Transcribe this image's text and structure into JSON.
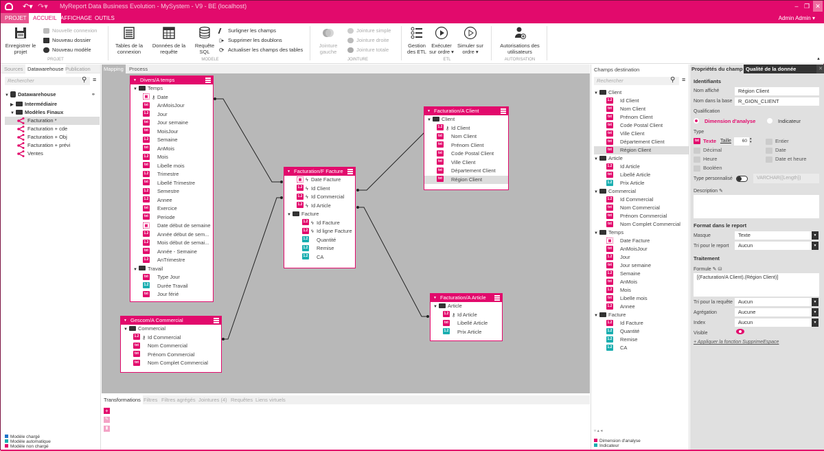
{
  "app": {
    "title": "MyReport Data Business Evolution - MySystem - V9 - BE (localhost)",
    "user": "Admin Admin",
    "accent": "#e20a6c",
    "measure_color": "#1aaeb0"
  },
  "ribbon_tabs": [
    "PROJET",
    "ACCUEIL",
    "AFFICHAGE",
    "OUTILS"
  ],
  "active_ribbon_tab": "ACCUEIL",
  "ribbon": {
    "projet": {
      "save": "Enregistrer le projet",
      "new_connection": "Nouvelle connexion",
      "new_folder": "Nouveau dossier",
      "new_model": "Nouveau modèle",
      "group": "PROJET"
    },
    "modele": {
      "tables": "Tables de la connexion",
      "data": "Données de la requête",
      "sql": "Requête SQL",
      "highlight": "Surligner les champs",
      "dedupe": "Supprimer les doublons",
      "refresh": "Actualiser les champs des tables",
      "group": "MODELE"
    },
    "jointure": {
      "left": "Jointure gauche",
      "simple": "Jointure simple",
      "right": "Jointure droite",
      "full": "Jointure totale",
      "group": "JOINTURE"
    },
    "etl": {
      "manage": "Gestion des ETL",
      "run": "Exécuter sur ordre ▾",
      "simulate": "Simuler sur ordre ▾",
      "group": "ETL"
    },
    "autorisation": {
      "users": "Autorisations des utilisateurs",
      "group": "AUTORISATION"
    }
  },
  "left_panel": {
    "tabs": [
      "Sources",
      "Datawarehouse",
      "Publication"
    ],
    "active_tab": "Datawarehouse",
    "search_placeholder": "Rechercher",
    "root": "Datawarehouse",
    "folders": [
      "Intermédiaire",
      "Modèles Finaux"
    ],
    "models": [
      "Facturation *",
      "Facturation + cde",
      "Facturation + Obj",
      "Facturation + prévi",
      "Ventes"
    ],
    "selected_model": "Facturation *",
    "legend": [
      {
        "label": "Modèle chargé",
        "color": "#1e73c8"
      },
      {
        "label": "Modèle automatique",
        "color": "#1aaeb0"
      },
      {
        "label": "Modèle non chargé",
        "color": "#e20a6c"
      }
    ]
  },
  "canvas": {
    "tabs": [
      "Mapping",
      "Process"
    ],
    "active_tab": "Mapping",
    "tables": {
      "temps": {
        "title": "Divers/A temps",
        "folders": [
          {
            "name": "Temps",
            "fields": [
              {
                "name": "Date",
                "type": "date",
                "key": true
              },
              {
                "name": "AnMoisJour",
                "type": "txt"
              },
              {
                "name": "Jour",
                "type": "num"
              },
              {
                "name": "Jour semaine",
                "type": "txt"
              },
              {
                "name": "MoisJour",
                "type": "txt"
              },
              {
                "name": "Semaine",
                "type": "num"
              },
              {
                "name": "AnMois",
                "type": "txt"
              },
              {
                "name": "Mois",
                "type": "num"
              },
              {
                "name": "Libelle mois",
                "type": "txt"
              },
              {
                "name": "Trimestre",
                "type": "num"
              },
              {
                "name": "Libellé Trimestre",
                "type": "txt"
              },
              {
                "name": "Semestre",
                "type": "num"
              },
              {
                "name": "Annee",
                "type": "num"
              },
              {
                "name": "Exercice",
                "type": "txt"
              },
              {
                "name": "Periode",
                "type": "txt"
              },
              {
                "name": "Date début de semaine",
                "type": "date"
              },
              {
                "name": "Année début de sem...",
                "type": "num"
              },
              {
                "name": "Mois début de semai...",
                "type": "num"
              },
              {
                "name": "Année - Semaine",
                "type": "txt"
              },
              {
                "name": "AnTrimestre",
                "type": "num"
              }
            ]
          },
          {
            "name": "Travail",
            "fields": [
              {
                "name": "Type Jour",
                "type": "txt"
              },
              {
                "name": "Durée Travail",
                "type": "numc"
              },
              {
                "name": "Jour férié",
                "type": "txt"
              }
            ]
          }
        ]
      },
      "facture": {
        "title": "Facturation/F Facture",
        "root_fields": [
          {
            "name": "Date Facture",
            "type": "date",
            "fk": true
          },
          {
            "name": "Id Client",
            "type": "num",
            "fk": true
          },
          {
            "name": "Id Commercial",
            "type": "num",
            "fk": true
          },
          {
            "name": "Id Article",
            "type": "num",
            "fk": true
          }
        ],
        "folders": [
          {
            "name": "Facture",
            "fields": [
              {
                "name": "Id Facture",
                "type": "num",
                "fk": true
              },
              {
                "name": "Id ligne Facture",
                "type": "num",
                "fk": true
              },
              {
                "name": "Quantité",
                "type": "numc"
              },
              {
                "name": "Remise",
                "type": "numc"
              },
              {
                "name": "CA",
                "type": "numc"
              }
            ]
          }
        ]
      },
      "client": {
        "title": "Facturation/A Client",
        "folders": [
          {
            "name": "Client",
            "fields": [
              {
                "name": "Id Client",
                "type": "num",
                "key": true
              },
              {
                "name": "Nom Client",
                "type": "txt"
              },
              {
                "name": "Prénom Client",
                "type": "txt"
              },
              {
                "name": "Code Postal Client",
                "type": "txt"
              },
              {
                "name": "Ville Client",
                "type": "txt"
              },
              {
                "name": "Département Client",
                "type": "txt"
              },
              {
                "name": "Région Client",
                "type": "txt",
                "selected": true
              }
            ]
          }
        ]
      },
      "commercial": {
        "title": "Gescom/A Commercial",
        "folders": [
          {
            "name": "Commercial",
            "fields": [
              {
                "name": "Id Commercial",
                "type": "num",
                "key": true
              },
              {
                "name": "Nom Commercial",
                "type": "txt"
              },
              {
                "name": "Prénom Commercial",
                "type": "txt"
              },
              {
                "name": "Nom Complet Commercial",
                "type": "txt"
              }
            ]
          }
        ]
      },
      "article": {
        "title": "Facturation/A Article",
        "folders": [
          {
            "name": "Article",
            "fields": [
              {
                "name": "Id Article",
                "type": "num",
                "key": true
              },
              {
                "name": "Libellé Article",
                "type": "txt"
              },
              {
                "name": "Prix Article",
                "type": "numc"
              }
            ]
          }
        ]
      }
    }
  },
  "bottom_panel": {
    "tabs": [
      "Transformations",
      "Filtres",
      "Filtres agrégés",
      "Jointures (4)",
      "Requêtes",
      "Liens virtuels"
    ],
    "active_tab": "Transformations"
  },
  "dest_panel": {
    "title": "Champs destination",
    "search_placeholder": "Rechercher",
    "folders": [
      {
        "name": "Client",
        "fields": [
          {
            "name": "Id Client",
            "type": "num"
          },
          {
            "name": "Nom Client",
            "type": "txt"
          },
          {
            "name": "Prénom Client",
            "type": "txt"
          },
          {
            "name": "Code Postal Client",
            "type": "txt"
          },
          {
            "name": "Ville Client",
            "type": "txt"
          },
          {
            "name": "Département Client",
            "type": "txt"
          },
          {
            "name": "Région Client",
            "type": "txt",
            "selected": true
          }
        ]
      },
      {
        "name": "Article",
        "fields": [
          {
            "name": "Id Article",
            "type": "num"
          },
          {
            "name": "Libellé Article",
            "type": "txt"
          },
          {
            "name": "Prix Article",
            "type": "numc"
          }
        ]
      },
      {
        "name": "Commercial",
        "fields": [
          {
            "name": "Id Commercial",
            "type": "num"
          },
          {
            "name": "Nom Commercial",
            "type": "txt"
          },
          {
            "name": "Prénom Commercial",
            "type": "txt"
          },
          {
            "name": "Nom Complet Commercial",
            "type": "txt"
          }
        ]
      },
      {
        "name": "Temps",
        "fields": [
          {
            "name": "Date Facture",
            "type": "date"
          },
          {
            "name": "AnMoisJour",
            "type": "txt"
          },
          {
            "name": "Jour",
            "type": "num"
          },
          {
            "name": "Jour semaine",
            "type": "txt"
          },
          {
            "name": "Semaine",
            "type": "num"
          },
          {
            "name": "AnMois",
            "type": "txt"
          },
          {
            "name": "Mois",
            "type": "num"
          },
          {
            "name": "Libelle mois",
            "type": "txt"
          },
          {
            "name": "Annee",
            "type": "num"
          }
        ]
      },
      {
        "name": "Facture",
        "fields": [
          {
            "name": "Id Facture",
            "type": "num"
          },
          {
            "name": "Quantité",
            "type": "numc"
          },
          {
            "name": "Remise",
            "type": "numc"
          },
          {
            "name": "CA",
            "type": "numc"
          }
        ]
      }
    ],
    "legend": [
      {
        "label": "Dimension d'analyse",
        "color": "#e20a6c"
      },
      {
        "label": "Indicateur",
        "color": "#1aaeb0"
      }
    ]
  },
  "properties": {
    "tabs": [
      "Propriétés du champ",
      "Qualité de la donnée"
    ],
    "identifiants": "Identifiants",
    "nom_affiche_label": "Nom affiché",
    "nom_affiche": "Région Client",
    "nom_base_label": "Nom dans la base",
    "nom_base": "R_GION_CLIENT",
    "qualification_label": "Qualification",
    "qualif_dimension": "Dimension d'analyse",
    "qualif_indicateur": "Indicateur",
    "type_label": "Type",
    "types": {
      "texte": "Texte",
      "taille_label": "Taille",
      "taille": "60",
      "entier": "Entier",
      "decimal": "Décimal",
      "date": "Date",
      "heure": "Heure",
      "dateheure": "Date et heure",
      "booleen": "Booléen"
    },
    "type_perso_label": "Type personnalisé",
    "type_perso_value": "VARCHAR({Length})",
    "description_label": "Description",
    "format_title": "Format dans le report",
    "masque_label": "Masque",
    "masque": "Texte",
    "tri_report_label": "Tri pour le report",
    "tri_report": "Aucun",
    "traitement_title": "Traitement",
    "formule_label": "Formule",
    "formule": "[(Facturation/A Client).(Région Client)]",
    "tri_requete_label": "Tri pour la requête",
    "tri_requete": "Aucun",
    "agregation_label": "Agrégation",
    "agregation": "Aucune",
    "index_label": "Index",
    "index": "Aucun",
    "visible_label": "Visible",
    "apply_link": "+ Appliquer la fonction SupprimeEspace"
  }
}
